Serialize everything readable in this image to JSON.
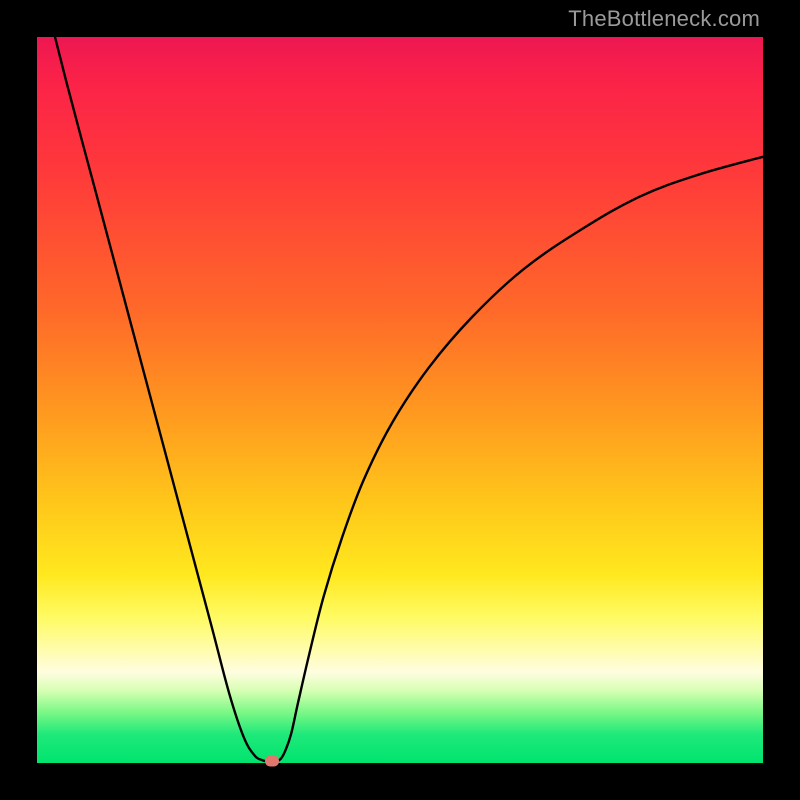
{
  "watermark": "TheBottleneck.com",
  "chart_data": {
    "type": "line",
    "title": "",
    "xlabel": "",
    "ylabel": "",
    "xlim": [
      0,
      1
    ],
    "ylim": [
      0,
      1
    ],
    "series": [
      {
        "name": "bottleneck-curve",
        "x": [
          0.0,
          0.04,
          0.08,
          0.12,
          0.16,
          0.2,
          0.24,
          0.265,
          0.285,
          0.3,
          0.31,
          0.318,
          0.324,
          0.33,
          0.336,
          0.342,
          0.35,
          0.36,
          0.375,
          0.395,
          0.42,
          0.45,
          0.49,
          0.54,
          0.6,
          0.67,
          0.75,
          0.83,
          0.91,
          1.0
        ],
        "values": [
          1.1,
          0.94,
          0.79,
          0.64,
          0.49,
          0.34,
          0.19,
          0.095,
          0.035,
          0.01,
          0.004,
          0.002,
          0.001,
          0.002,
          0.006,
          0.017,
          0.04,
          0.085,
          0.15,
          0.23,
          0.31,
          0.39,
          0.47,
          0.545,
          0.615,
          0.68,
          0.735,
          0.78,
          0.81,
          0.835
        ]
      }
    ],
    "marker": {
      "x": 0.324,
      "y": 0.003
    },
    "gradient_stops": [
      {
        "pos": 0.0,
        "color": "#ed1752"
      },
      {
        "pos": 0.06,
        "color": "#fb2248"
      },
      {
        "pos": 0.19,
        "color": "#ff3a3a"
      },
      {
        "pos": 0.38,
        "color": "#ff6a29"
      },
      {
        "pos": 0.52,
        "color": "#ff9a1f"
      },
      {
        "pos": 0.64,
        "color": "#ffc61a"
      },
      {
        "pos": 0.74,
        "color": "#ffe81e"
      },
      {
        "pos": 0.8,
        "color": "#fffb64"
      },
      {
        "pos": 0.875,
        "color": "#fffde0"
      },
      {
        "pos": 0.9,
        "color": "#d7ffb3"
      },
      {
        "pos": 0.93,
        "color": "#7cf886"
      },
      {
        "pos": 0.96,
        "color": "#1fe97a"
      },
      {
        "pos": 1.0,
        "color": "#00e46e"
      }
    ]
  }
}
